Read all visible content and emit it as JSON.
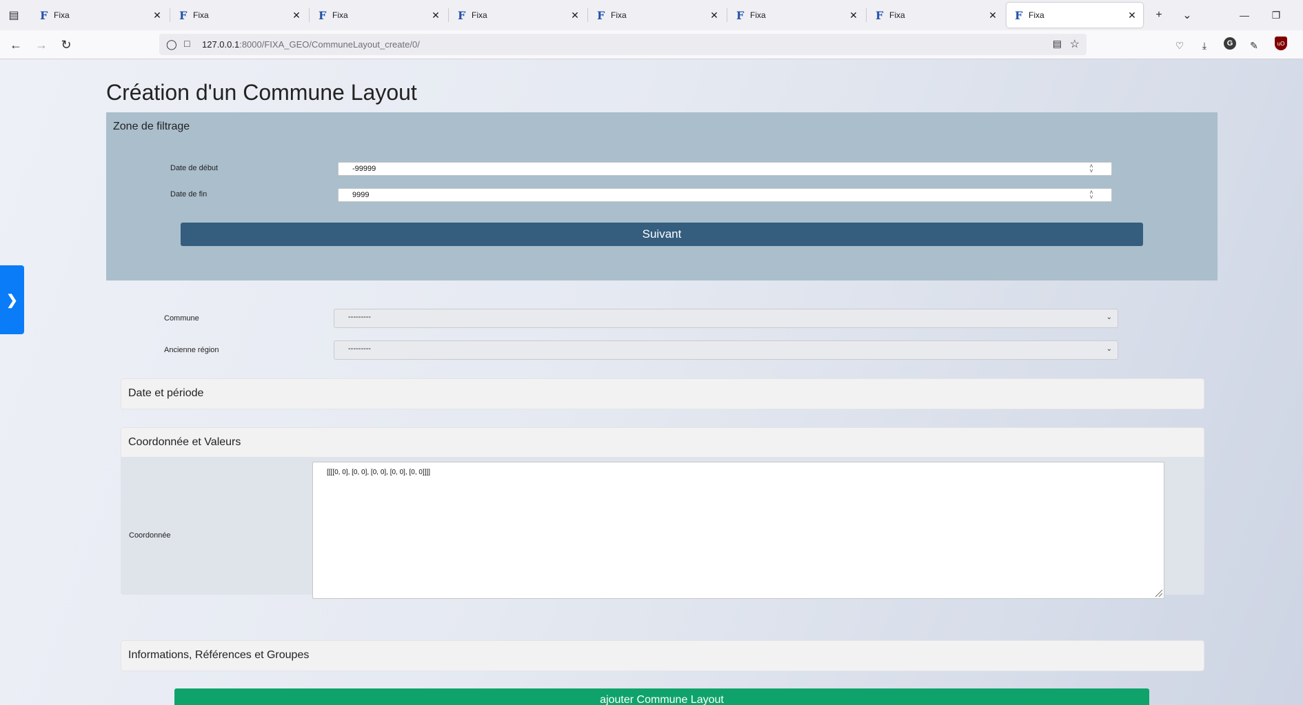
{
  "browser": {
    "tabs": [
      {
        "title": "Fixa",
        "favicon": "F"
      },
      {
        "title": "Fixa",
        "favicon": "F"
      },
      {
        "title": "Fixa",
        "favicon": "F"
      },
      {
        "title": "Fixa",
        "favicon": "F"
      },
      {
        "title": "Fixa",
        "favicon": "F"
      },
      {
        "title": "Fixa",
        "favicon": "F"
      },
      {
        "title": "Fixa",
        "favicon": "F"
      },
      {
        "title": "Fixa",
        "favicon": "F"
      }
    ],
    "active_tab_index": 7,
    "url_host": "127.0.0.1",
    "url_path": ":8000/FIXA_GEO/CommuneLayout_create/0/",
    "extension_avatar_letter": "G",
    "ublock_label": "uO"
  },
  "page": {
    "title": "Création d'un Commune Layout",
    "filter_zone": {
      "title": "Zone de filtrage",
      "date_debut_label": "Date de début",
      "date_debut_value": "-99999",
      "date_fin_label": "Date de fin",
      "date_fin_value": "9999",
      "next_button": "Suivant"
    },
    "commune": {
      "label": "Commune",
      "selected": "---------"
    },
    "ancienne_region": {
      "label": "Ancienne région",
      "selected": "---------"
    },
    "sections": {
      "date_periode": "Date et période",
      "coord_valeurs": "Coordonnée et Valeurs",
      "infos": "Informations, Références et Groupes"
    },
    "coordonnee": {
      "label": "Coordonnée",
      "value": "[[[[0, 0], [0, 0], [0, 0], [0, 0], [0, 0]]]]"
    },
    "submit_button": "ajouter Commune Layout"
  },
  "colors": {
    "filter_zone_bg": "#aabecc",
    "next_button": "#345d7e",
    "submit_button": "#0fa36b",
    "side_toggle": "#0a7cf7"
  },
  "icons": {
    "tab_list": "tab-list-icon",
    "back": "back-arrow-icon",
    "forward": "forward-arrow-icon",
    "reload": "reload-icon",
    "shield": "tracking-protection-shield-icon",
    "reader": "reader-view-icon",
    "bookmark": "bookmark-star-icon",
    "pocket": "pocket-icon",
    "downloads": "download-icon",
    "extensions": "extensions-puzzle-icon",
    "side_toggle": "chevron-right-icon"
  }
}
